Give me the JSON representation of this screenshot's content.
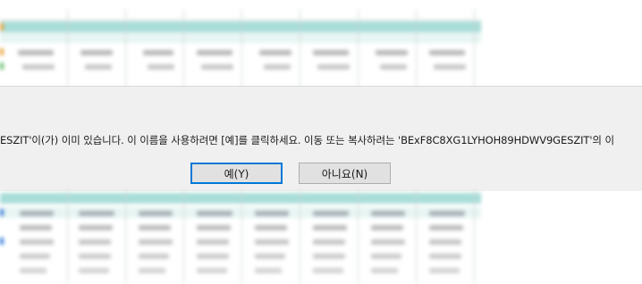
{
  "dialog": {
    "message": "ESZIT'이(가) 이미 있습니다. 이 이름을 사용하려면 [예]를 클릭하세요. 이동 또는 복사하려는 'BExF8C8XG1LYHOH89HDWV9GESZIT'의 이",
    "yes_label": "예(Y)",
    "no_label": "아니요(N)"
  },
  "colors": {
    "header_teal": "#a8ddd8",
    "green_accent": "#6fbf73",
    "orange_accent": "#e8a33a",
    "focus_border": "#0078d7"
  }
}
